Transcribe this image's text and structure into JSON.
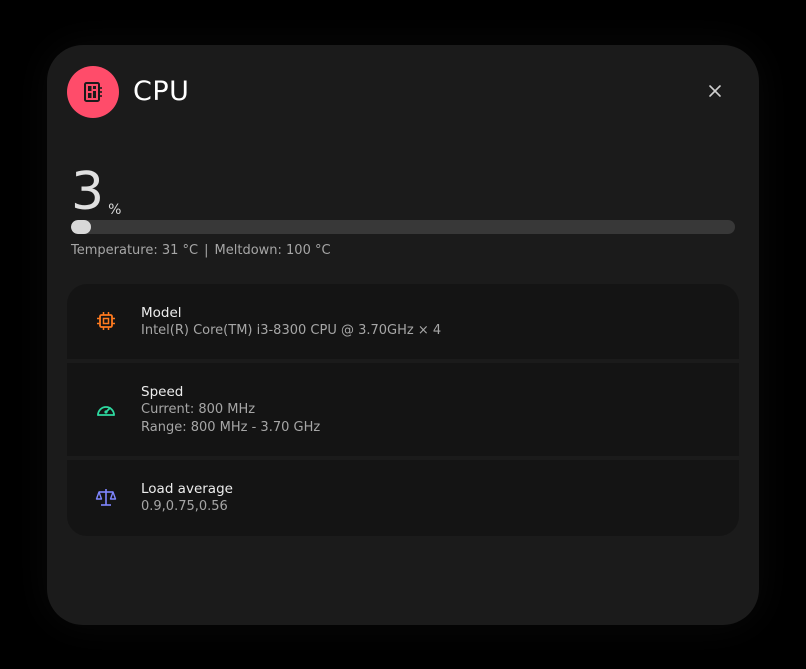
{
  "dialog": {
    "title": "CPU",
    "icon": "cpu-board-icon",
    "accent_color": "#ff4c6a"
  },
  "usage": {
    "value": "3",
    "unit": "%",
    "fraction": 0.03,
    "temperature_text": "Temperature: 31 °C",
    "separator": "|",
    "meltdown_text": "Meltdown: 100 °C"
  },
  "cards": {
    "model": {
      "icon": "chip-icon",
      "icon_color": "#ff7a1f",
      "title": "Model",
      "value": "Intel(R) Core(TM) i3-8300 CPU @ 3.70GHz × 4"
    },
    "speed": {
      "icon": "speedometer-icon",
      "icon_color": "#2ed9a0",
      "title": "Speed",
      "current": "Current: 800 MHz",
      "range": "Range: 800 MHz - 3.70 GHz"
    },
    "load": {
      "icon": "balance-scale-icon",
      "icon_color": "#7f86ff",
      "title": "Load average",
      "value": "0.9,0.75,0.56"
    }
  }
}
